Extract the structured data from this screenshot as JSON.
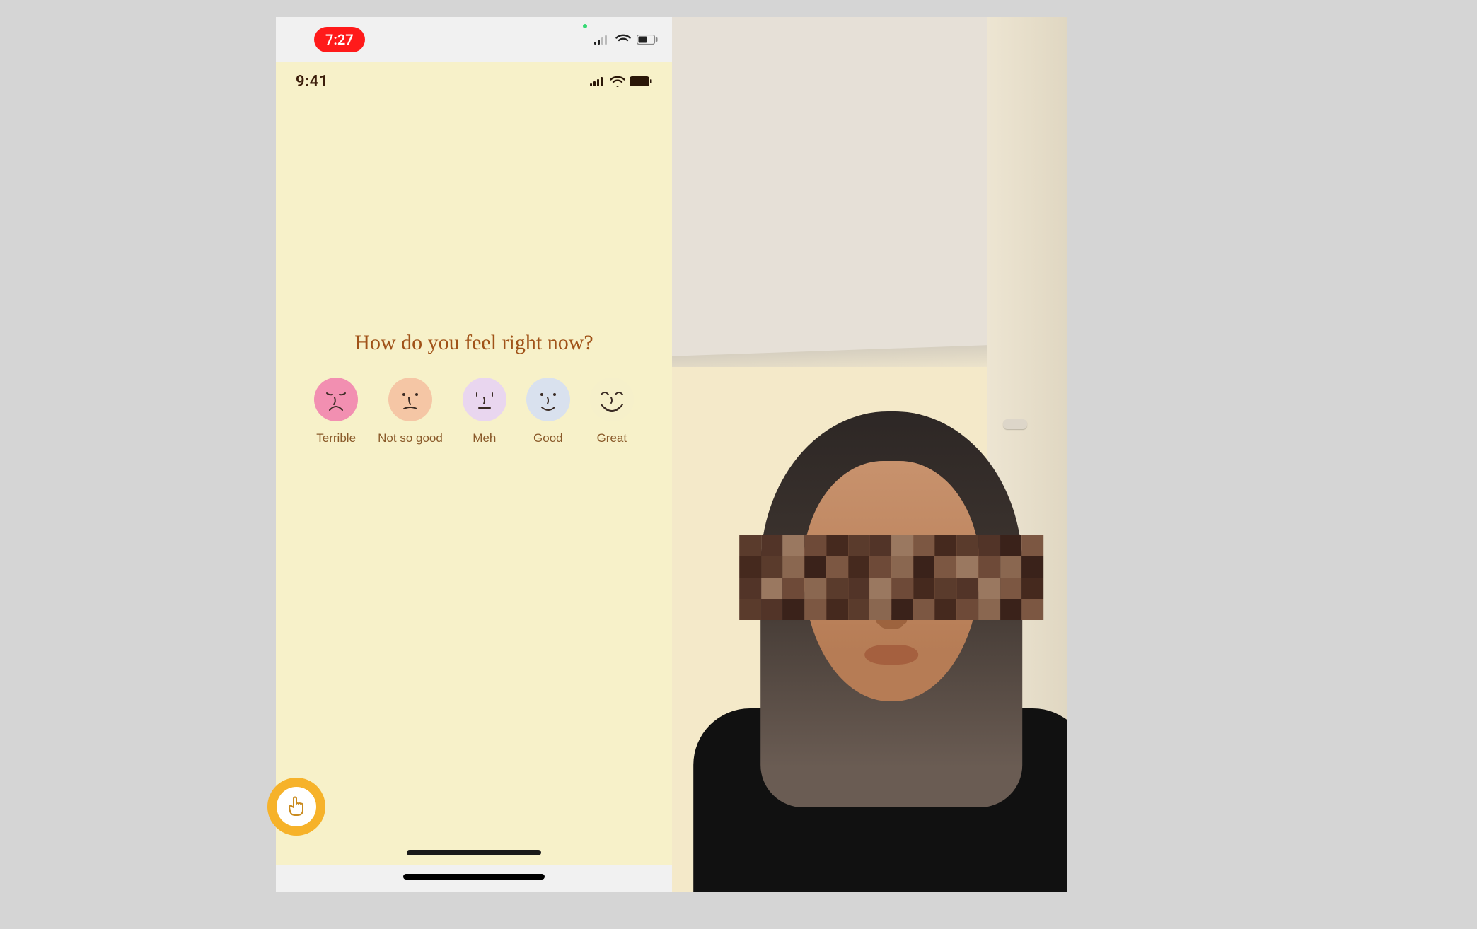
{
  "outer_status": {
    "recording_time": "7:27"
  },
  "app_status": {
    "time": "9:41"
  },
  "prompt": {
    "question": "How do you feel right now?"
  },
  "moods": [
    {
      "key": "terrible",
      "label": "Terrible",
      "face_class": "face-terrible"
    },
    {
      "key": "notsogood",
      "label": "Not so good",
      "face_class": "face-notsogood"
    },
    {
      "key": "meh",
      "label": "Meh",
      "face_class": "face-meh"
    },
    {
      "key": "good",
      "label": "Good",
      "face_class": "face-good"
    },
    {
      "key": "great",
      "label": "Great",
      "face_class": "face-great"
    }
  ],
  "colors": {
    "accent": "#a05218",
    "squeeze": "#f6b22a",
    "bg": "#f7f1c9"
  }
}
